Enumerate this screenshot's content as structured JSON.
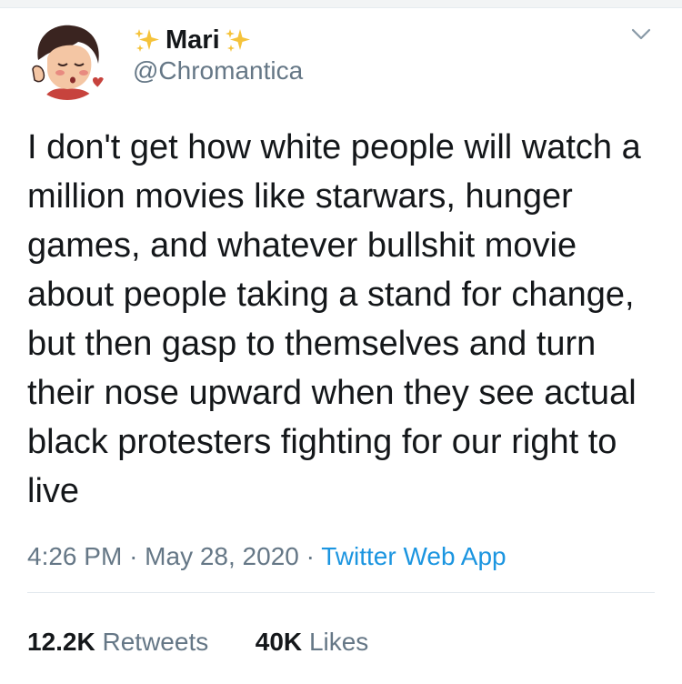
{
  "user": {
    "display_name": "Mari",
    "handle": "@Chromantica"
  },
  "tweet": {
    "text": "I don't get how white people will watch a million movies like starwars, hunger games, and whatever bullshit movie about people taking a stand for change, but then gasp to themselves and turn their nose upward when they see actual black protesters fighting for our right to live",
    "time": "4:26 PM",
    "separator": "·",
    "date": "May 28, 2020",
    "source": "Twitter Web App"
  },
  "stats": {
    "retweets_count": "12.2K",
    "retweets_label": "Retweets",
    "likes_count": "40K",
    "likes_label": "Likes"
  },
  "icons": {
    "sparkle": "sparkle-icon",
    "caret": "chevron-down-icon"
  },
  "colors": {
    "text": "#14171a",
    "secondary": "#657786",
    "link": "#1b95e0",
    "sparkle": "#f5c33b"
  }
}
